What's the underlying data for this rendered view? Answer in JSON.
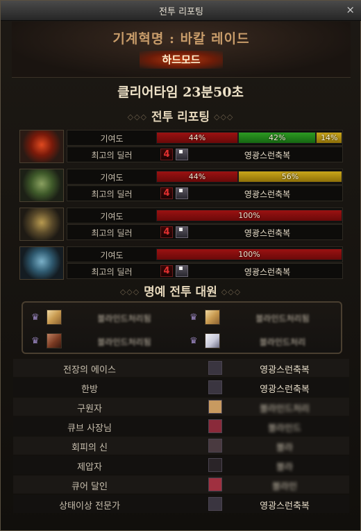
{
  "window": {
    "title": "전투 리포팅",
    "close_glyph": "×"
  },
  "raid": {
    "name": "기계혁명 : 바칼 레이드",
    "mode": "하드모드",
    "clear_time": "클리어타임  23분50초"
  },
  "report": {
    "section_title": "전투 리포팅",
    "ornament_left": "◇◇◇",
    "ornament_right": "◇◇◇",
    "contribution_label": "기여도",
    "best_dealer_label": "최고의 딜러",
    "dealer_icon_glyph": "4",
    "players": [
      {
        "portrait": "red-armor-portrait",
        "contribution": [
          {
            "pct": 44,
            "text": "44%",
            "color": "#8f1010"
          },
          {
            "pct": 42,
            "text": "42%",
            "color": "#2a8a1e"
          },
          {
            "pct": 14,
            "text": "14%",
            "color": "#b8920e"
          }
        ],
        "best_dealer": "영광스런축복"
      },
      {
        "portrait": "green-armor-portrait",
        "contribution": [
          {
            "pct": 44,
            "text": "44%",
            "color": "#8f1010"
          },
          {
            "pct": 56,
            "text": "56%",
            "color": "#b8920e"
          }
        ],
        "best_dealer": "영광스런축복"
      },
      {
        "portrait": "gold-armor-portrait",
        "contribution": [
          {
            "pct": 100,
            "text": "100%",
            "color": "#8f1010"
          }
        ],
        "best_dealer": "영광스런축복"
      },
      {
        "portrait": "blue-armor-portrait",
        "contribution": [
          {
            "pct": 100,
            "text": "100%",
            "color": "#8f1010"
          }
        ],
        "best_dealer": "영광스런축복"
      }
    ]
  },
  "honor": {
    "section_title": "명예 전투 대원",
    "ornament_left": "◇◇◇",
    "ornament_right": "◇◇◇",
    "members": [
      {
        "name": "블라인드처리됨",
        "avatar": "blonde-character"
      },
      {
        "name": "블라인드처리됨",
        "avatar": "blonde-character"
      },
      {
        "name": "블라인드처리됨",
        "avatar": "brown-hair-character"
      },
      {
        "name": "블라인드처리",
        "avatar": "white-hair-character"
      }
    ]
  },
  "awards": [
    {
      "title": "전장의 에이스",
      "name": "영광스런축복",
      "blurred": false
    },
    {
      "title": "한방",
      "name": "영광스런축복",
      "blurred": false
    },
    {
      "title": "구원자",
      "name": "블라인드처리",
      "blurred": true
    },
    {
      "title": "큐브 사장님",
      "name": "블라인드",
      "blurred": true
    },
    {
      "title": "회피의 신",
      "name": "블라",
      "blurred": true
    },
    {
      "title": "제압자",
      "name": "블라",
      "blurred": true
    },
    {
      "title": "큐어 달인",
      "name": "블라인",
      "blurred": true
    },
    {
      "title": "상태이상 전문가",
      "name": "영광스런축복",
      "blurred": false
    }
  ]
}
